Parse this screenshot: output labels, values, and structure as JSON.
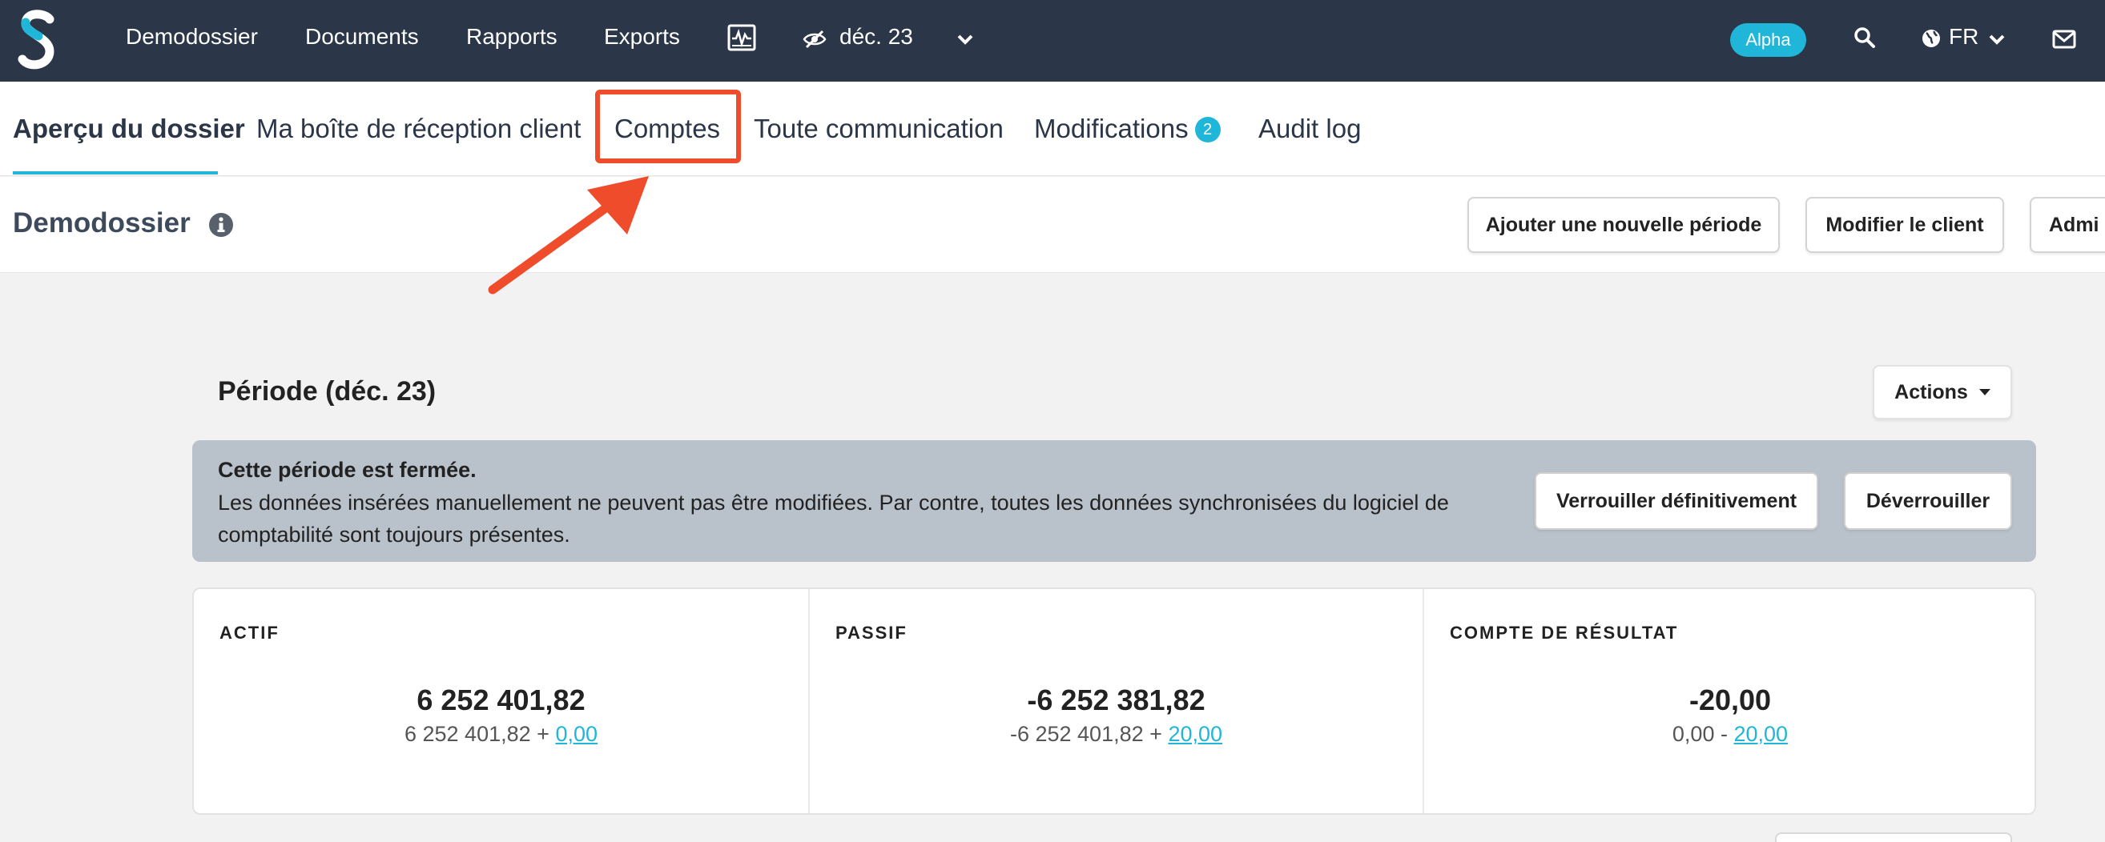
{
  "nav": {
    "items": [
      "Demodossier",
      "Documents",
      "Rapports",
      "Exports"
    ],
    "period": "déc. 23",
    "alpha_badge": "Alpha",
    "language": "FR"
  },
  "tabs": {
    "items": [
      "Aperçu du dossier",
      "Ma boîte de réception client",
      "Comptes",
      "Toute communication",
      "Modifications",
      "Audit log"
    ],
    "modifications_count": "2"
  },
  "header": {
    "title": "Demodossier",
    "buttons": [
      "Ajouter une nouvelle période",
      "Modifier le client",
      "Admi"
    ]
  },
  "period": {
    "title": "Période (déc. 23)",
    "actions_label": "Actions"
  },
  "banner": {
    "title": "Cette période est fermée.",
    "text": "Les données insérées manuellement ne peuvent pas être modifiées. Par contre, toutes les données synchronisées du logiciel de comptabilité sont toujours présentes.",
    "lock_label": "Verrouiller définitivement",
    "unlock_label": "Déverrouiller"
  },
  "summary": [
    {
      "label": "ACTIF",
      "total": "6 252 401,82",
      "base": "6 252 401,82",
      "op": "+",
      "adjust": "0,00"
    },
    {
      "label": "PASSIF",
      "total": "-6 252 381,82",
      "base": "-6 252 401,82",
      "op": "+",
      "adjust": "20,00"
    },
    {
      "label": "COMPTE DE RÉSULTAT",
      "total": "-20,00",
      "base": "0,00",
      "op": "-",
      "adjust": "20,00"
    }
  ],
  "colors": {
    "nav_bg": "#2b3648",
    "accent": "#1fb6d9",
    "highlight": "#ee4c2b",
    "banner_bg": "#b9c1cb"
  },
  "icons": [
    "logo-icon",
    "activity-monitor-icon",
    "eye-slash-icon",
    "chevron-down-icon",
    "search-icon",
    "globe-icon",
    "mail-icon",
    "info-icon",
    "arrow-annotation"
  ]
}
